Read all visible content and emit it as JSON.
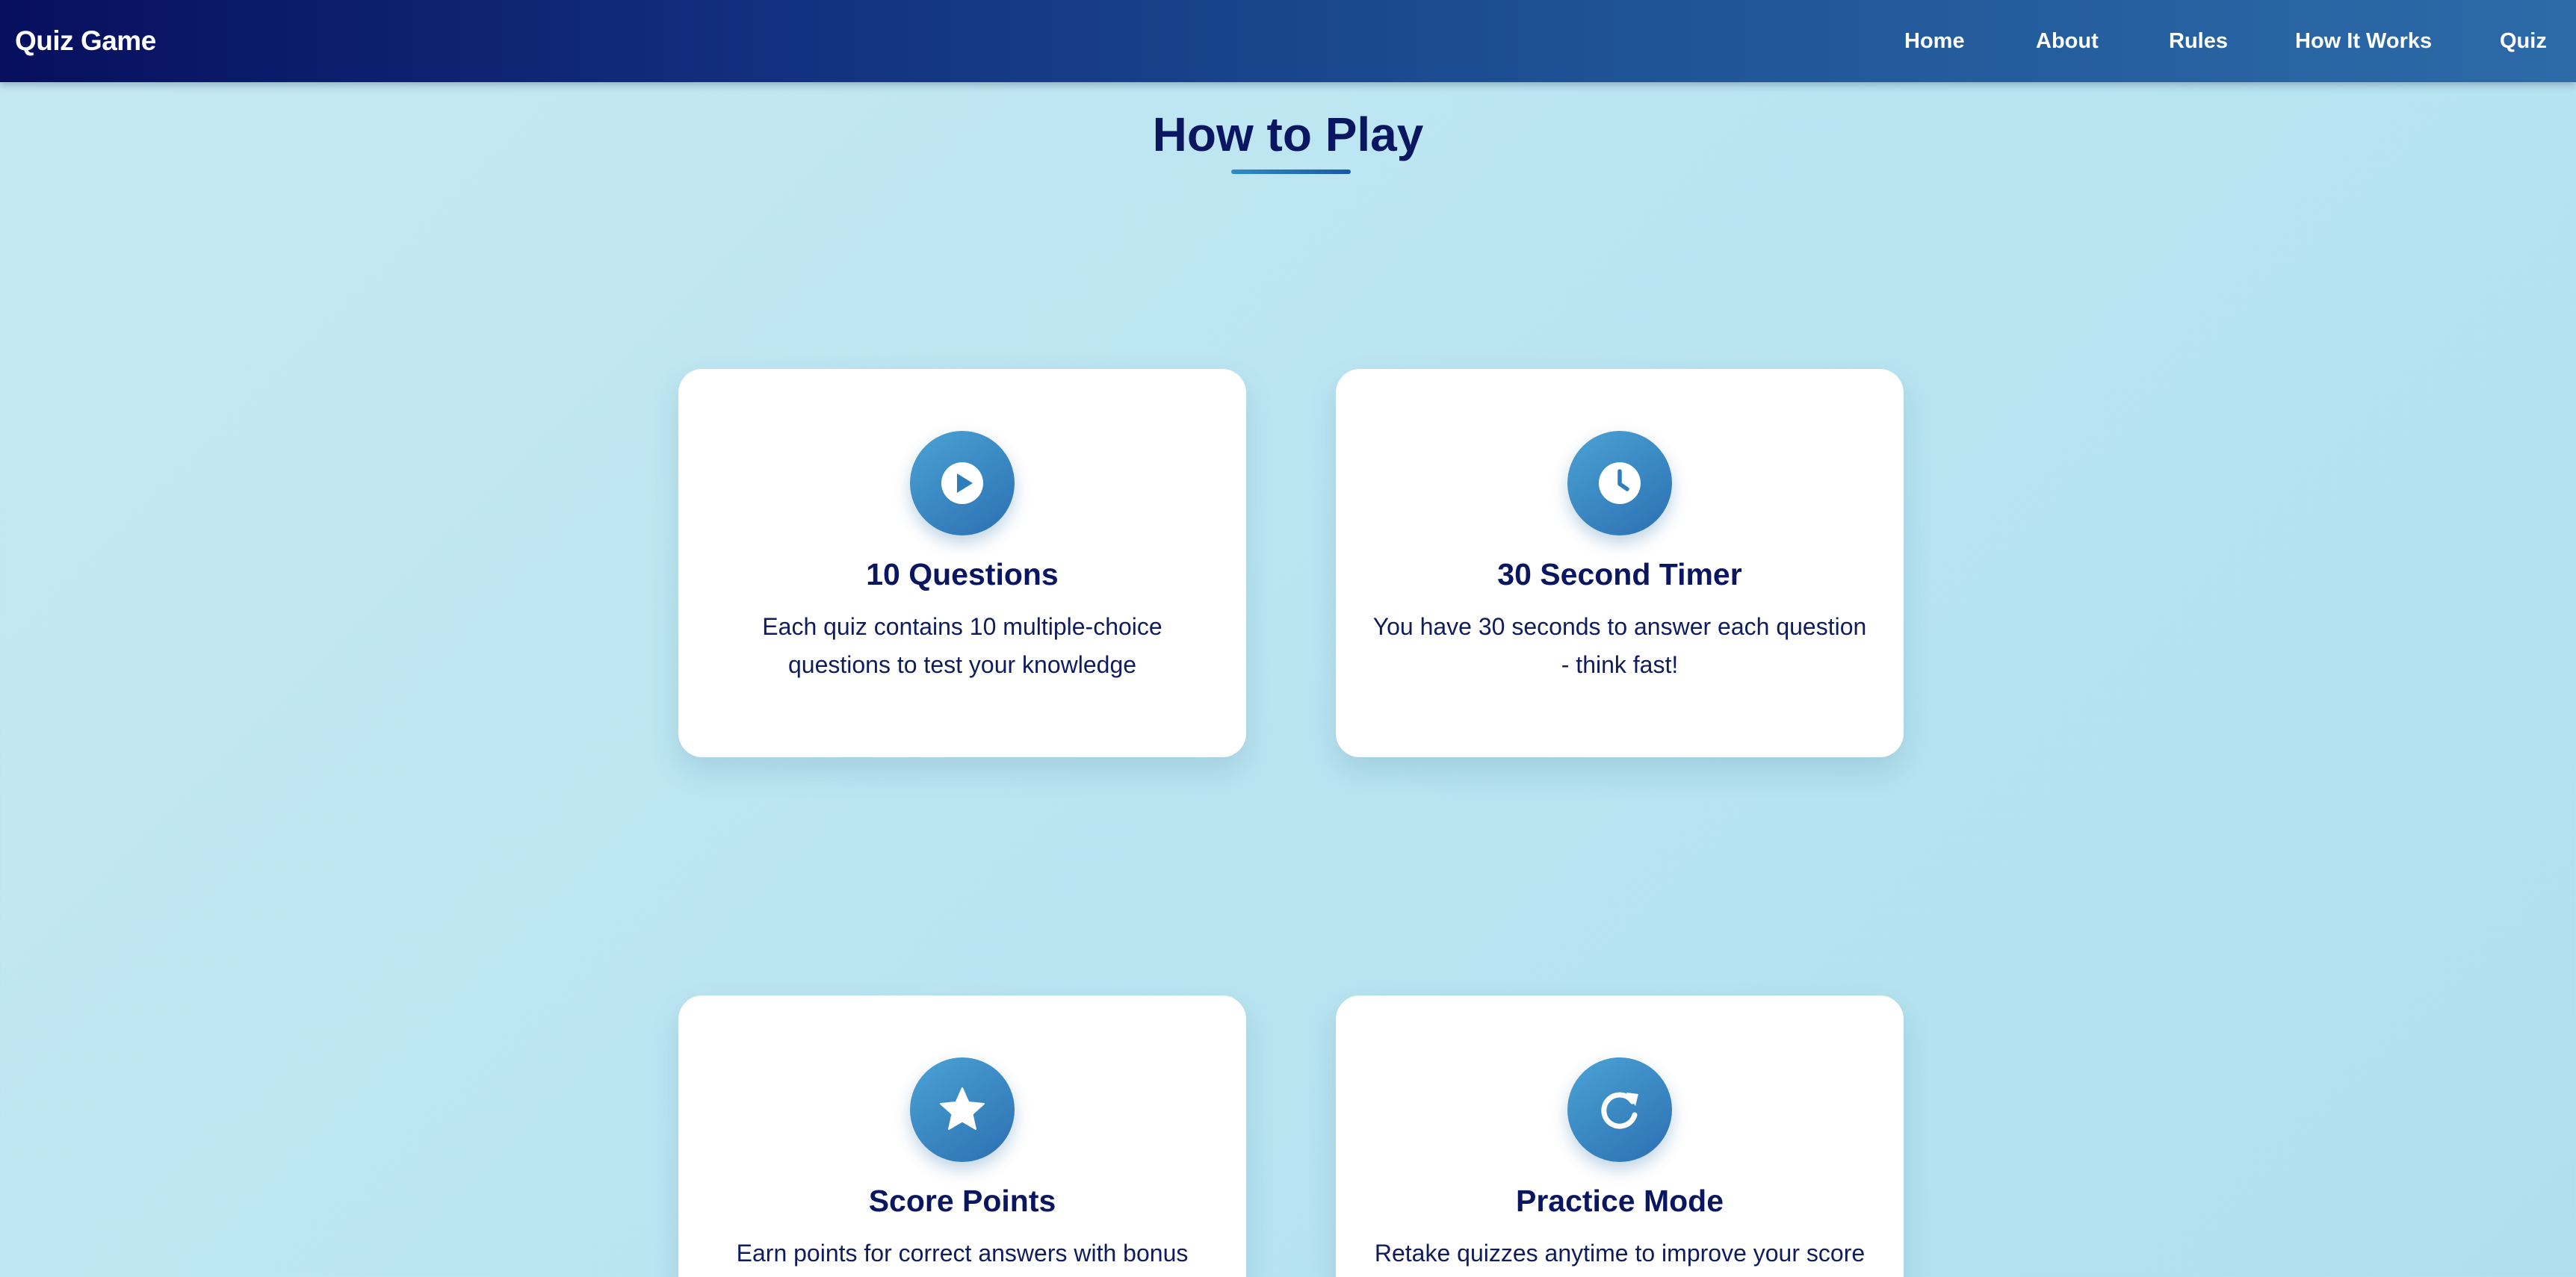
{
  "header": {
    "brand": "Quiz Game",
    "nav": [
      {
        "label": "Home"
      },
      {
        "label": "About"
      },
      {
        "label": "Rules"
      },
      {
        "label": "How It Works"
      },
      {
        "label": "Quiz"
      }
    ]
  },
  "main": {
    "title": "How to Play",
    "cards": [
      {
        "icon": "play-circle-icon",
        "title": "10 Questions",
        "text": "Each quiz contains 10 multiple-choice questions to test your knowledge"
      },
      {
        "icon": "clock-icon",
        "title": "30 Second Timer",
        "text": "You have 30 seconds to answer each question - think fast!"
      },
      {
        "icon": "star-icon",
        "title": "Score Points",
        "text": "Earn points for correct answers with bonus"
      },
      {
        "icon": "redo-icon",
        "title": "Practice Mode",
        "text": "Retake quizzes anytime to improve your score"
      }
    ]
  },
  "colors": {
    "nav_gradient_start": "#070f5e",
    "nav_gradient_end": "#2d6aa8",
    "background": "#bee6f2",
    "heading": "#0a1660",
    "icon_gradient_start": "#4aa3d4",
    "icon_gradient_end": "#2c6fb2",
    "card_background": "#ffffff"
  }
}
